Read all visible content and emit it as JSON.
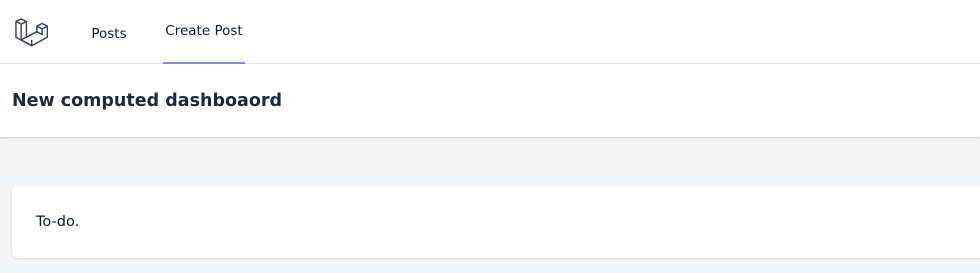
{
  "nav": {
    "logo_icon": "laravel-logo-icon",
    "links": [
      {
        "label": "Posts",
        "active": false
      },
      {
        "label": "Create Post",
        "active": true
      }
    ],
    "active_underline_color": "#818cf8"
  },
  "header": {
    "title": "New computed dashboaord"
  },
  "content": {
    "card_text": "To-do."
  }
}
